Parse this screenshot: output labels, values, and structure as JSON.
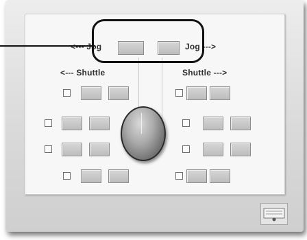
{
  "labels": {
    "jog_left": "<--- Jog",
    "jog_right": "Jog --->",
    "shuttle_left": "<--- Shuttle",
    "shuttle_right": "Shuttle --->"
  },
  "icons": {
    "knob": "jog-shuttle-knob",
    "logo": "device-logo-icon"
  }
}
